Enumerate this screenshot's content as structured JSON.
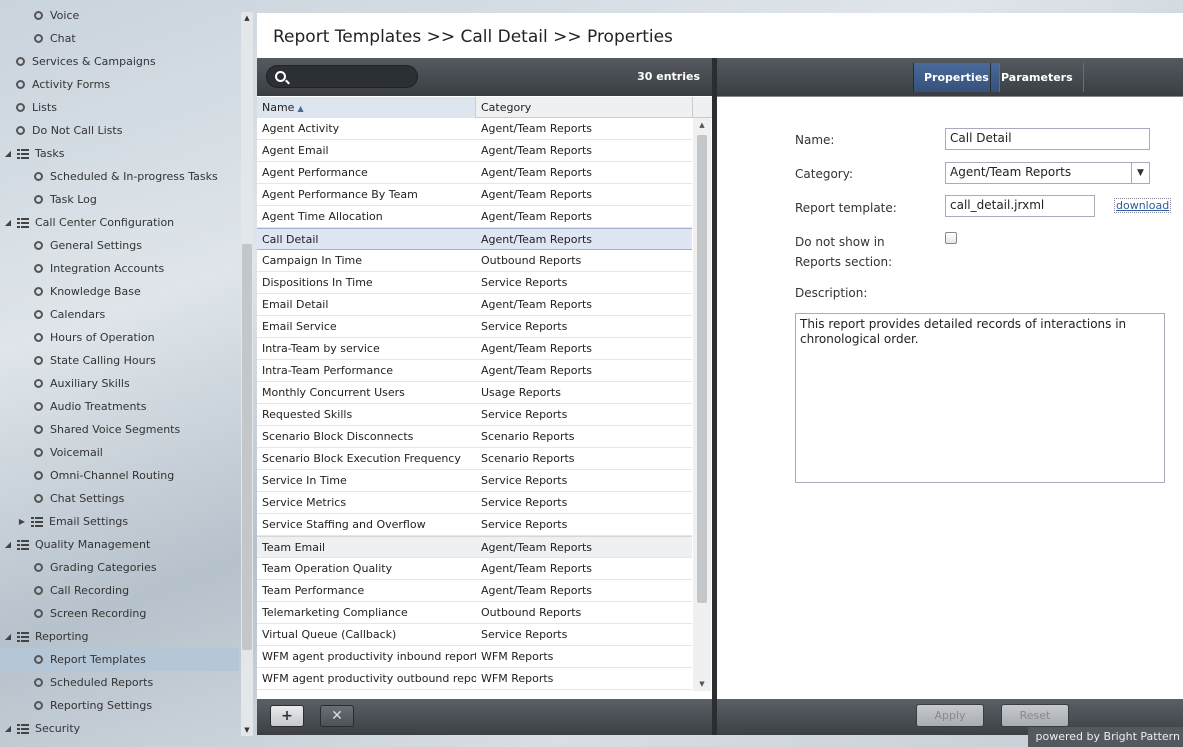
{
  "sidebar": {
    "items": [
      {
        "label": "Voice",
        "type": "leaf",
        "depth": 2
      },
      {
        "label": "Chat",
        "type": "leaf",
        "depth": 2
      },
      {
        "label": "Services & Campaigns",
        "type": "leaf",
        "depth": 1
      },
      {
        "label": "Activity Forms",
        "type": "leaf",
        "depth": 1
      },
      {
        "label": "Lists",
        "type": "leaf",
        "depth": 1
      },
      {
        "label": "Do Not Call Lists",
        "type": "leaf",
        "depth": 1
      },
      {
        "label": "Tasks",
        "type": "group",
        "depth": 0,
        "expanded": true
      },
      {
        "label": "Scheduled & In-progress Tasks",
        "type": "leaf",
        "depth": 2
      },
      {
        "label": "Task Log",
        "type": "leaf",
        "depth": 2
      },
      {
        "label": "Call Center Configuration",
        "type": "group",
        "depth": 0,
        "expanded": true
      },
      {
        "label": "General Settings",
        "type": "leaf",
        "depth": 2
      },
      {
        "label": "Integration Accounts",
        "type": "leaf",
        "depth": 2
      },
      {
        "label": "Knowledge Base",
        "type": "leaf",
        "depth": 2
      },
      {
        "label": "Calendars",
        "type": "leaf",
        "depth": 2
      },
      {
        "label": "Hours of Operation",
        "type": "leaf",
        "depth": 2
      },
      {
        "label": "State Calling Hours",
        "type": "leaf",
        "depth": 2
      },
      {
        "label": "Auxiliary Skills",
        "type": "leaf",
        "depth": 2
      },
      {
        "label": "Audio Treatments",
        "type": "leaf",
        "depth": 2
      },
      {
        "label": "Shared Voice Segments",
        "type": "leaf",
        "depth": 2
      },
      {
        "label": "Voicemail",
        "type": "leaf",
        "depth": 2
      },
      {
        "label": "Omni-Channel Routing",
        "type": "leaf",
        "depth": 2
      },
      {
        "label": "Chat Settings",
        "type": "leaf",
        "depth": 2
      },
      {
        "label": "Email Settings",
        "type": "group",
        "depth": 1,
        "expanded": false
      },
      {
        "label": "Quality Management",
        "type": "group",
        "depth": 0,
        "expanded": true
      },
      {
        "label": "Grading Categories",
        "type": "leaf",
        "depth": 2
      },
      {
        "label": "Call Recording",
        "type": "leaf",
        "depth": 2
      },
      {
        "label": "Screen Recording",
        "type": "leaf",
        "depth": 2
      },
      {
        "label": "Reporting",
        "type": "group",
        "depth": 0,
        "expanded": true
      },
      {
        "label": "Report Templates",
        "type": "leaf",
        "depth": 2,
        "selected": true
      },
      {
        "label": "Scheduled Reports",
        "type": "leaf",
        "depth": 2
      },
      {
        "label": "Reporting Settings",
        "type": "leaf",
        "depth": 2
      },
      {
        "label": "Security",
        "type": "group",
        "depth": 0,
        "expanded": true
      }
    ]
  },
  "header": {
    "title": "Report Templates >> Call Detail >> Properties"
  },
  "list": {
    "search_placeholder": "",
    "entries_count": "30 entries",
    "columns": [
      "Name",
      "Category"
    ],
    "rows": [
      {
        "name": "Agent Activity",
        "category": "Agent/Team Reports"
      },
      {
        "name": "Agent Email",
        "category": "Agent/Team Reports"
      },
      {
        "name": "Agent Performance",
        "category": "Agent/Team Reports"
      },
      {
        "name": "Agent Performance By Team",
        "category": "Agent/Team Reports"
      },
      {
        "name": "Agent Time Allocation",
        "category": "Agent/Team Reports"
      },
      {
        "name": "Call Detail",
        "category": "Agent/Team Reports",
        "selected": true
      },
      {
        "name": "Campaign In Time",
        "category": "Outbound Reports"
      },
      {
        "name": "Dispositions In Time",
        "category": "Service Reports"
      },
      {
        "name": "Email Detail",
        "category": "Agent/Team Reports"
      },
      {
        "name": "Email Service",
        "category": "Service Reports"
      },
      {
        "name": "Intra-Team by service",
        "category": "Agent/Team Reports"
      },
      {
        "name": "Intra-Team Performance",
        "category": "Agent/Team Reports"
      },
      {
        "name": "Monthly Concurrent Users",
        "category": "Usage Reports"
      },
      {
        "name": "Requested Skills",
        "category": "Service Reports"
      },
      {
        "name": "Scenario Block Disconnects",
        "category": "Scenario Reports"
      },
      {
        "name": "Scenario Block Execution Frequency",
        "category": "Scenario Reports"
      },
      {
        "name": "Service In Time",
        "category": "Service Reports"
      },
      {
        "name": "Service Metrics",
        "category": "Service Reports"
      },
      {
        "name": "Service Staffing and Overflow",
        "category": "Service Reports"
      },
      {
        "name": "Team Email",
        "category": "Agent/Team Reports",
        "hover": true
      },
      {
        "name": "Team Operation Quality",
        "category": "Agent/Team Reports"
      },
      {
        "name": "Team Performance",
        "category": "Agent/Team Reports"
      },
      {
        "name": "Telemarketing Compliance",
        "category": "Outbound Reports"
      },
      {
        "name": "Virtual Queue (Callback)",
        "category": "Service Reports"
      },
      {
        "name": "WFM agent productivity inbound report",
        "category": "WFM Reports"
      },
      {
        "name": "WFM agent productivity outbound report",
        "category": "WFM Reports"
      }
    ],
    "add_label": "+",
    "delete_label": "✕"
  },
  "properties": {
    "tabs": [
      "Properties",
      "Parameters"
    ],
    "active_tab": "Properties",
    "name_label": "Name:",
    "name_value": "Call Detail",
    "category_label": "Category:",
    "category_value": "Agent/Team Reports",
    "template_label": "Report template:",
    "template_value": "call_detail.jrxml",
    "download_label": "download",
    "hide_label_line1": "Do not show in",
    "hide_label_line2": "Reports section:",
    "hide_checked": false,
    "description_label": "Description:",
    "description_value": "This report provides detailed records of interactions in chronological order.",
    "apply_label": "Apply",
    "reset_label": "Reset"
  },
  "footer": {
    "powered_by": "powered by Bright Pattern"
  },
  "colors": {
    "accent": "#3b5685",
    "selected_row": "#dde6f2",
    "sidebar_selected": "#b5c6d7",
    "toolbar": "#43474c"
  }
}
